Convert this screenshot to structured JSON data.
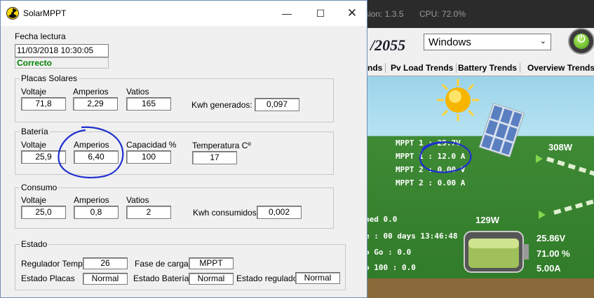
{
  "background_app": {
    "topbar": {
      "version": "sion: 1.3.5",
      "cpu": "CPU:  72.0%"
    },
    "logo_fragment": "/2055",
    "os_select": {
      "value": "Windows"
    },
    "tabs": [
      "nds",
      "Pv Load Trends",
      "Battery Trends",
      "Overview Trends"
    ],
    "scene": {
      "mppt_lines": [
        "MPPT 1 :  25.7V",
        "MPPT 1 :  12.0 A",
        "MPPT 2 :  0.00 V",
        "MPPT 2 :  0.00 A"
      ],
      "left_lines": [
        "ned   0.0",
        "e : 00 days 13:46:48",
        "o Go :  0.0",
        "o 100 :  0.0"
      ],
      "power_top": "308W",
      "power_batt": "129W",
      "battery_stats": [
        "25.86V",
        "71.00 %",
        "5.00A"
      ]
    }
  },
  "window": {
    "title": "SolarMPPT",
    "fecha_label": "Fecha lectura",
    "fecha_value": "11/03/2018 10:30:05",
    "status": "Correcto",
    "placas": {
      "title": "Placas Solares",
      "voltaje_label": "Voltaje",
      "voltaje": "71,8",
      "amperios_label": "Amperios",
      "amperios": "2,29",
      "vatios_label": "Vatios",
      "vatios": "165",
      "kwh_label": "Kwh generados:",
      "kwh": "0,097"
    },
    "bateria": {
      "title": "Batería",
      "voltaje_label": "Voltaje",
      "voltaje": "25,9",
      "amperios_label": "Amperios",
      "amperios": "6,40",
      "capacidad_label": "Capacidad %",
      "capacidad": "100",
      "temp_label": "Temperatura Cº",
      "temp": "17"
    },
    "consumo": {
      "title": "Consumo",
      "voltaje_label": "Voltaje",
      "voltaje": "25,0",
      "amperios_label": "Amperios",
      "amperios": "0,8",
      "vatios_label": "Vatios",
      "vatios": "2",
      "kwh_label": "Kwh consumidos:",
      "kwh": "0,002"
    },
    "estado": {
      "title": "Estado",
      "reg_temp_label": "Regulador Temp.",
      "reg_temp": "26",
      "fase_label": "Fase de carga:",
      "fase": "MPPT",
      "placas_label": "Estado Placas",
      "placas": "Normal",
      "bateria_label": "Estado Batería",
      "bateria": "Normal",
      "regulador_label": "Estado regulador",
      "regulador": "Normal"
    }
  },
  "colors": {
    "status_green": "#008000",
    "annotation_blue": "#1f2fd0"
  }
}
